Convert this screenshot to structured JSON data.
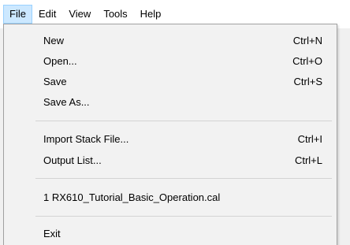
{
  "menubar": {
    "items": [
      {
        "label": "File"
      },
      {
        "label": "Edit"
      },
      {
        "label": "View"
      },
      {
        "label": "Tools"
      },
      {
        "label": "Help"
      }
    ]
  },
  "file_menu": {
    "new": {
      "label": "New",
      "shortcut": "Ctrl+N"
    },
    "open": {
      "label": "Open...",
      "shortcut": "Ctrl+O"
    },
    "save": {
      "label": "Save",
      "shortcut": "Ctrl+S"
    },
    "save_as": {
      "label": "Save As..."
    },
    "import_stack": {
      "label": "Import Stack File...",
      "shortcut": "Ctrl+I"
    },
    "output_list": {
      "label": "Output List...",
      "shortcut": "Ctrl+L"
    },
    "recent_1": {
      "label": "1 RX610_Tutorial_Basic_Operation.cal"
    },
    "exit": {
      "label": "Exit"
    }
  }
}
